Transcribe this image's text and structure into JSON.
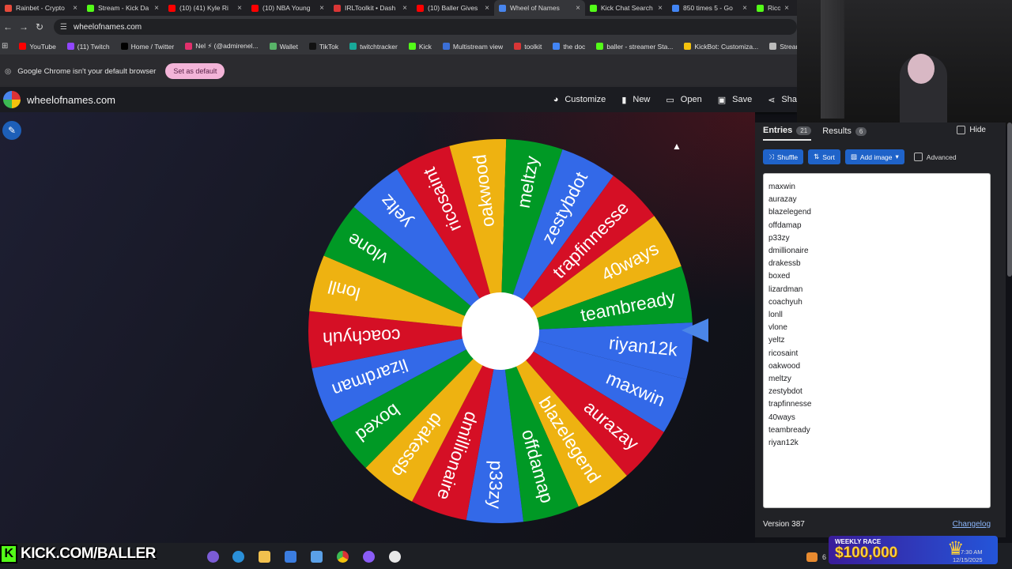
{
  "tabs": [
    {
      "label": "Rainbet - Crypto",
      "color": "#e64a3b"
    },
    {
      "label": "Stream - Kick Da",
      "color": "#53fc18"
    },
    {
      "label": "(10) (41) Kyle Ri",
      "color": "#ff0000"
    },
    {
      "label": "(10) NBA Young",
      "color": "#ff0000"
    },
    {
      "label": "IRLToolkit • Dash",
      "color": "#d93636"
    },
    {
      "label": "(10) Baller Gives",
      "color": "#ff0000"
    },
    {
      "label": "Wheel of Names",
      "color": "#4885ed",
      "active": true
    },
    {
      "label": "Kick Chat Search",
      "color": "#53fc18"
    },
    {
      "label": "850 times 5 - Go",
      "color": "#4285f4"
    },
    {
      "label": "RicoSai",
      "color": "#53fc18"
    }
  ],
  "address": {
    "url": "wheelofnames.com"
  },
  "bookmarks": [
    {
      "label": "YouTube",
      "color": "#ff0000"
    },
    {
      "label": "(11) Twitch",
      "color": "#9146ff"
    },
    {
      "label": "Home / Twitter",
      "color": "#000000"
    },
    {
      "label": "Nel ⚡ (@admirenel...",
      "color": "#e1306c"
    },
    {
      "label": "Wallet",
      "color": "#58b368"
    },
    {
      "label": "TikTok",
      "color": "#111111"
    },
    {
      "label": "twitchtracker",
      "color": "#18a999"
    },
    {
      "label": "Kick",
      "color": "#53fc18"
    },
    {
      "label": "Multistream view",
      "color": "#3b6fd6"
    },
    {
      "label": "toolkit",
      "color": "#d93636"
    },
    {
      "label": "the doc",
      "color": "#4285f4"
    },
    {
      "label": "baller - streamer Sta...",
      "color": "#53fc18"
    },
    {
      "label": "KickBot: Customiza...",
      "color": "#f4c20d"
    },
    {
      "label": "Streamed - Wa",
      "color": "#bbbbbb"
    }
  ],
  "notice": {
    "text": "Google Chrome isn't your default browser",
    "button": "Set as default"
  },
  "app": {
    "site": "wheelofnames.com",
    "buttons": {
      "customize": "Customize",
      "new": "New",
      "open": "Open",
      "save": "Save",
      "share": "Sha"
    }
  },
  "wheel": {
    "entries": [
      "maxwin",
      "aurazay",
      "blazelegend",
      "offdamap",
      "p33zy",
      "dmillionaire",
      "drakessb",
      "boxed",
      "lizardman",
      "coachyuh",
      "lonll",
      "vlone",
      "yeltz",
      "ricosaint",
      "oakwood",
      "meltzy",
      "zestybdot",
      "trapfinnesse",
      "40ways",
      "teambready",
      "riyan12k"
    ],
    "colors": [
      "#3369e8",
      "#d50f25",
      "#eeb211",
      "#009925"
    ],
    "pointer_color": "#4b86e8"
  },
  "panel": {
    "entries_tab": "Entries",
    "entries_count": "21",
    "results_tab": "Results",
    "results_count": "6",
    "hide": "Hide",
    "shuffle": "Shuffle",
    "sort": "Sort",
    "add_image": "Add image",
    "advanced": "Advanced",
    "version": "Version 387",
    "changelog": "Changelog"
  },
  "overlay": {
    "kick": "KICK.COM/BALLER",
    "race_title": "WEEKLY RACE",
    "race_amount": "$100,000",
    "clock_time": "7:30 AM",
    "clock_date": "12/15/2025",
    "tray_num": "6"
  }
}
